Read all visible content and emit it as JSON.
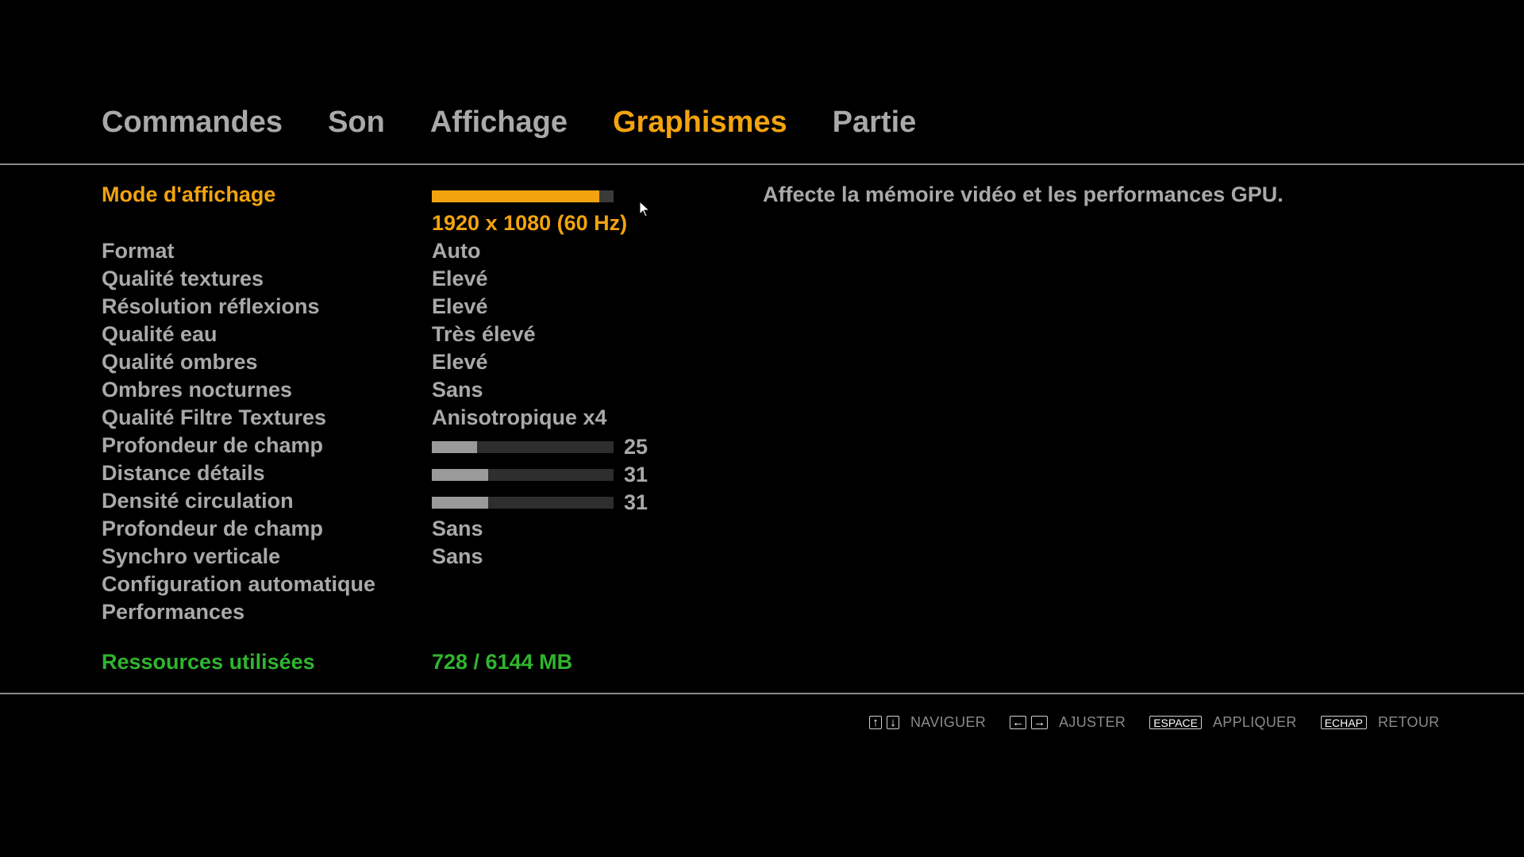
{
  "tabs": [
    {
      "label": "Commandes",
      "active": false
    },
    {
      "label": "Son",
      "active": false
    },
    {
      "label": "Affichage",
      "active": false
    },
    {
      "label": "Graphismes",
      "active": true
    },
    {
      "label": "Partie",
      "active": false
    }
  ],
  "colors": {
    "accent": "#f2a30f",
    "text": "#a9a9a9",
    "resources": "#2fb52f",
    "background": "#000000"
  },
  "description": "Affecte la mémoire vidéo et les performances GPU.",
  "settings": [
    {
      "label": "Mode d'affichage",
      "value": "1920 x 1080 (60 Hz)",
      "slider_fraction": 0.92
    },
    {
      "label": "Format",
      "value": "Auto"
    },
    {
      "label": "Qualité textures",
      "value": "Elevé"
    },
    {
      "label": "Résolution réflexions",
      "value": "Elevé"
    },
    {
      "label": "Qualité eau",
      "value": "Très élevé"
    },
    {
      "label": "Qualité ombres",
      "value": "Elevé"
    },
    {
      "label": "Ombres nocturnes",
      "value": "Sans"
    },
    {
      "label": "Qualité Filtre Textures",
      "value": "Anisotropique x4"
    },
    {
      "label": "Profondeur de champ",
      "value": 25,
      "max": 100
    },
    {
      "label": "Distance détails",
      "value": 31,
      "max": 100
    },
    {
      "label": "Densité circulation",
      "value": 31,
      "max": 100
    },
    {
      "label": "Profondeur de champ",
      "value": "Sans"
    },
    {
      "label": "Synchro verticale",
      "value": "Sans"
    },
    {
      "label": "Configuration automatique"
    },
    {
      "label": "Performances"
    }
  ],
  "resources": {
    "label": "Ressources utilisées",
    "value": "728 / 6144 MB"
  },
  "hints": [
    {
      "keys": [
        "↑",
        "↓"
      ],
      "label": "NAVIGUER",
      "icon": "arrow-keys-up-down"
    },
    {
      "keys": [
        "←",
        "→"
      ],
      "label": "AJUSTER",
      "icon": "arrow-keys-left-right"
    },
    {
      "keys": [
        "ESPACE"
      ],
      "label": "APPLIQUER"
    },
    {
      "keys": [
        "ECHAP"
      ],
      "label": "RETOUR"
    }
  ]
}
